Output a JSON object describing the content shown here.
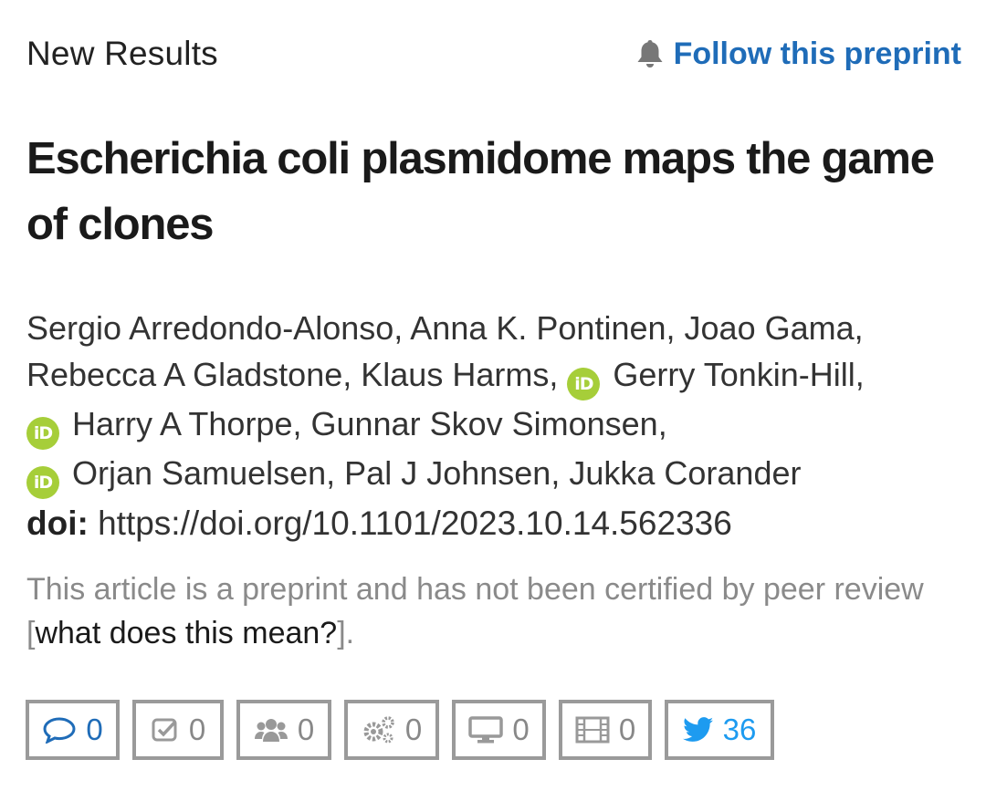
{
  "header": {
    "status_label": "New Results",
    "follow_label": "Follow this preprint"
  },
  "article": {
    "title": "Escherichia coli plasmidome maps the game of clones",
    "authors": [
      "Sergio Arredondo-Alonso",
      "Anna K. Pontinen",
      "Joao Gama",
      "Rebecca A Gladstone",
      "Klaus Harms",
      "Gerry Tonkin-Hill",
      "Harry A Thorpe",
      "Gunnar Skov Simonsen",
      "Orjan Samuelsen",
      "Pal J Johnsen",
      "Jukka Corander"
    ],
    "orcid_badge_text": "iD",
    "doi_label": "doi:",
    "doi_url": "https://doi.org/10.1101/2023.10.14.562336",
    "disclaimer_text": "This article is a preprint and has not been certified by peer review",
    "disclaimer_link": "what does this mean?",
    "bracket_open": "[",
    "bracket_close": "].",
    "separator": ", "
  },
  "metrics": {
    "comments": "0",
    "reviews": "0",
    "community": "0",
    "automated": "0",
    "media": "0",
    "video": "0",
    "tweets": "36"
  },
  "colors": {
    "link_blue": "#1f6cb8",
    "twitter_blue": "#1d9bf0",
    "orcid_green": "#a6ce39",
    "badge_border": "#9a9a9a"
  },
  "icons": {
    "follow": "bell-icon",
    "comments": "speech-bubble-icon",
    "reviews": "checkbox-icon",
    "community": "users-icon",
    "automated": "gears-icon",
    "media": "monitor-icon",
    "video": "film-icon",
    "tweets": "twitter-bird-icon",
    "orcid": "orcid-icon"
  }
}
